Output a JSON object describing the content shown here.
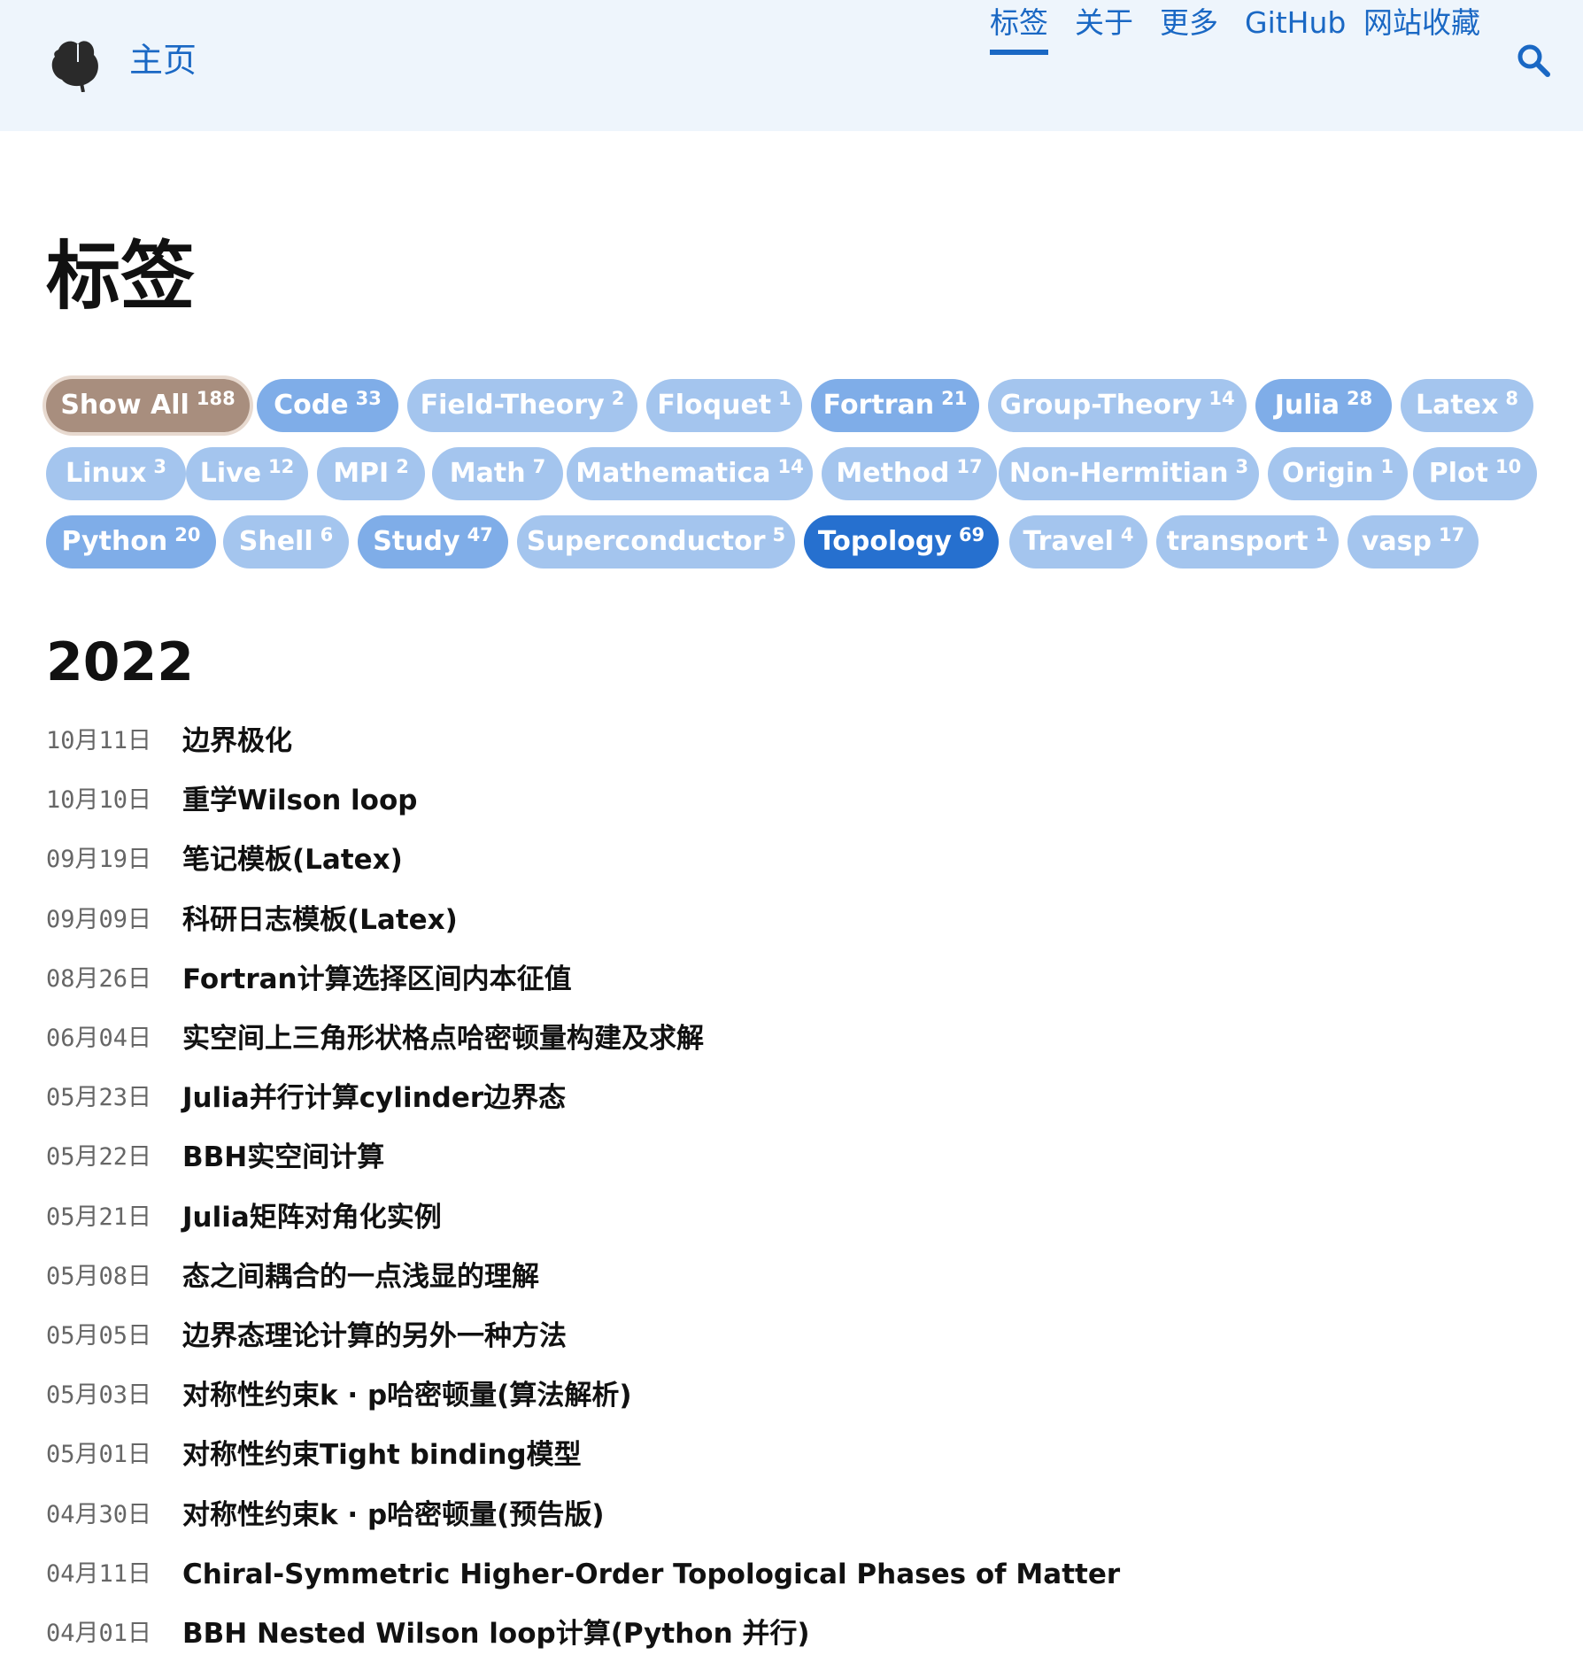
{
  "header": {
    "home_label": "主页",
    "nav": [
      {
        "label": "标签",
        "active": true
      },
      {
        "label": "关于",
        "active": false
      },
      {
        "label": "更多",
        "active": false
      },
      {
        "label": "GitHub",
        "active": false
      },
      {
        "label": "网站收藏",
        "active": false
      }
    ],
    "search_icon": "search-icon",
    "logo_icon": "ginkgo-leaf-icon"
  },
  "page_title": "标签",
  "tags": [
    {
      "name": "Show All",
      "count": "188",
      "style": "showall"
    },
    {
      "name": "Code",
      "count": "33",
      "style": "mid"
    },
    {
      "name": "Field-Theory",
      "count": "2",
      "style": "light"
    },
    {
      "name": "Floquet",
      "count": "1",
      "style": "light"
    },
    {
      "name": "Fortran",
      "count": "21",
      "style": "mid"
    },
    {
      "name": "Group-Theory",
      "count": "14",
      "style": "light"
    },
    {
      "name": "Julia",
      "count": "28",
      "style": "mid"
    },
    {
      "name": "Latex",
      "count": "8",
      "style": "light"
    },
    {
      "name": "Linux",
      "count": "3",
      "style": "light"
    },
    {
      "name": "Live",
      "count": "12",
      "style": "light"
    },
    {
      "name": "MPI",
      "count": "2",
      "style": "light"
    },
    {
      "name": "Math",
      "count": "7",
      "style": "light"
    },
    {
      "name": "Mathematica",
      "count": "14",
      "style": "light"
    },
    {
      "name": "Method",
      "count": "17",
      "style": "light"
    },
    {
      "name": "Non-Hermitian",
      "count": "3",
      "style": "light"
    },
    {
      "name": "Origin",
      "count": "1",
      "style": "light"
    },
    {
      "name": "Plot",
      "count": "10",
      "style": "light"
    },
    {
      "name": "Python",
      "count": "20",
      "style": "mid"
    },
    {
      "name": "Shell",
      "count": "6",
      "style": "light"
    },
    {
      "name": "Study",
      "count": "47",
      "style": "mid"
    },
    {
      "name": "Superconductor",
      "count": "5",
      "style": "light"
    },
    {
      "name": "Topology",
      "count": "69",
      "style": "dark"
    },
    {
      "name": "Travel",
      "count": "4",
      "style": "light"
    },
    {
      "name": "transport",
      "count": "1",
      "style": "light"
    },
    {
      "name": "vasp",
      "count": "17",
      "style": "light"
    }
  ],
  "year": "2022",
  "posts": [
    {
      "date": "10月11日",
      "title": "边界极化"
    },
    {
      "date": "10月10日",
      "title": "重学Wilson loop"
    },
    {
      "date": "09月19日",
      "title": "笔记模板(Latex)"
    },
    {
      "date": "09月09日",
      "title": "科研日志模板(Latex)"
    },
    {
      "date": "08月26日",
      "title": "Fortran计算选择区间内本征值"
    },
    {
      "date": "06月04日",
      "title": "实空间上三角形状格点哈密顿量构建及求解"
    },
    {
      "date": "05月23日",
      "title": "Julia并行计算cylinder边界态"
    },
    {
      "date": "05月22日",
      "title": "BBH实空间计算"
    },
    {
      "date": "05月21日",
      "title": "Julia矩阵对角化实例"
    },
    {
      "date": "05月08日",
      "title": "态之间耦合的一点浅显的理解"
    },
    {
      "date": "05月05日",
      "title": "边界态理论计算的另外一种方法"
    },
    {
      "date": "05月03日",
      "title": "对称性约束k · p哈密顿量(算法解析)"
    },
    {
      "date": "05月01日",
      "title": "对称性约束Tight binding模型"
    },
    {
      "date": "04月30日",
      "title": "对称性约束k · p哈密顿量(预告版)"
    },
    {
      "date": "04月11日",
      "title": "Chiral-Symmetric Higher-Order Topological Phases of Matter"
    },
    {
      "date": "04月01日",
      "title": "BBH Nested Wilson loop计算(Python 并行)"
    }
  ]
}
